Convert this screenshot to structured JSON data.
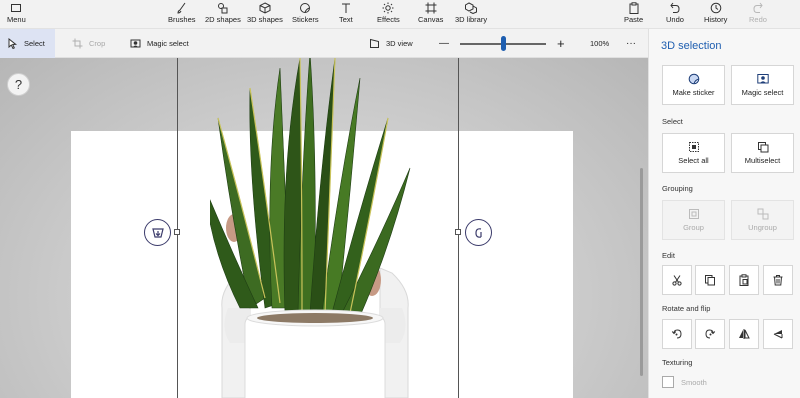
{
  "topbar": {
    "menu": "Menu",
    "tools": [
      "Brushes",
      "2D shapes",
      "3D shapes",
      "Stickers",
      "Text",
      "Effects",
      "Canvas",
      "3D library"
    ],
    "paste": "Paste",
    "undo": "Undo",
    "history": "History",
    "redo": "Redo"
  },
  "toolbar": {
    "select": "Select",
    "crop": "Crop",
    "magic_select": "Magic select",
    "view_3d": "3D view",
    "zoom_minus": "—",
    "zoom_plus": "+",
    "zoom_level": "100%",
    "more": "···",
    "zoom_fraction": 0.5
  },
  "canvas": {
    "help": "?"
  },
  "panel": {
    "title": "3D selection",
    "make_sticker": "Make sticker",
    "magic_select": "Magic select",
    "select_label": "Select",
    "select_all": "Select all",
    "multiselect": "Multiselect",
    "grouping_label": "Grouping",
    "group": "Group",
    "ungroup": "Ungroup",
    "edit_label": "Edit",
    "rotate_label": "Rotate and flip",
    "texturing_label": "Texturing",
    "smooth": "Smooth"
  },
  "colors": {
    "accent": "#1e5eb0",
    "selected_bg": "#dde3f3",
    "disabled_text": "#aaaaaa"
  }
}
